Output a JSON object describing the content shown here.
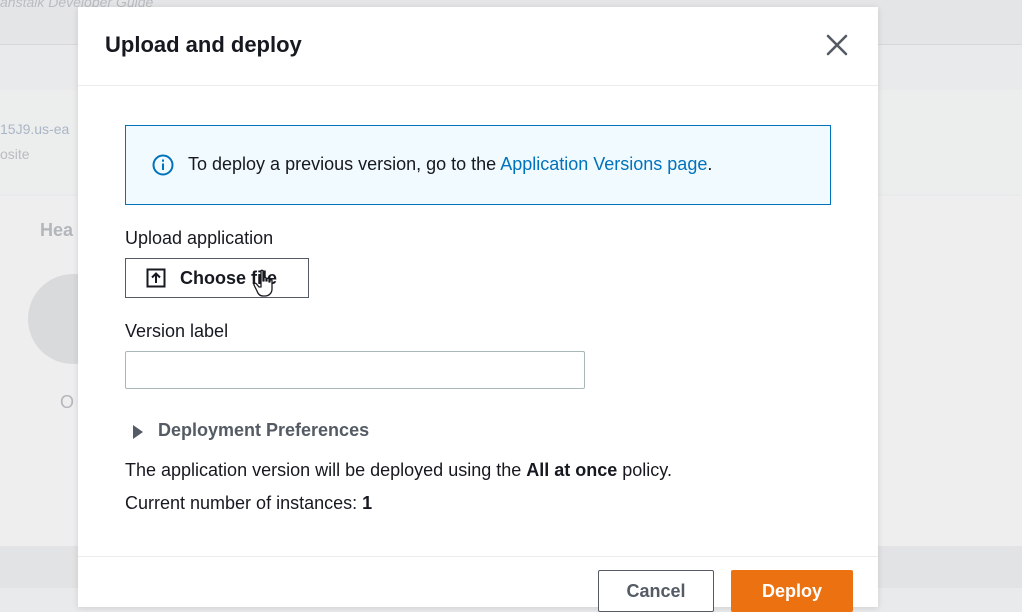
{
  "background": {
    "header_text": "anstalk Developer Guide",
    "link_text": "15J9.us-ea",
    "sub_text": "osite",
    "panel_title": "Hea",
    "status_text": "O"
  },
  "modal": {
    "title": "Upload and deploy",
    "info": {
      "text_before": "To deploy a previous version, go to the ",
      "link": "Application Versions page",
      "text_after": "."
    },
    "upload": {
      "label": "Upload application",
      "button_label": "Choose file"
    },
    "version": {
      "label": "Version label",
      "value": "",
      "placeholder": ""
    },
    "preferences": {
      "label": "Deployment Preferences"
    },
    "policy": {
      "prefix": "The application version will be deployed using the ",
      "policy_name": "All at once",
      "suffix": " policy."
    },
    "instances": {
      "prefix": "Current number of instances: ",
      "count": "1"
    },
    "footer": {
      "cancel_label": "Cancel",
      "deploy_label": "Deploy"
    }
  },
  "colors": {
    "link": "#0073bb",
    "info_bg": "#f1faff",
    "primary_button": "#ec7211"
  },
  "icons": {
    "close": "close-icon",
    "info": "info-icon",
    "upload": "upload-icon",
    "caret": "caret-right-icon",
    "cursor": "hand-pointer-icon"
  }
}
